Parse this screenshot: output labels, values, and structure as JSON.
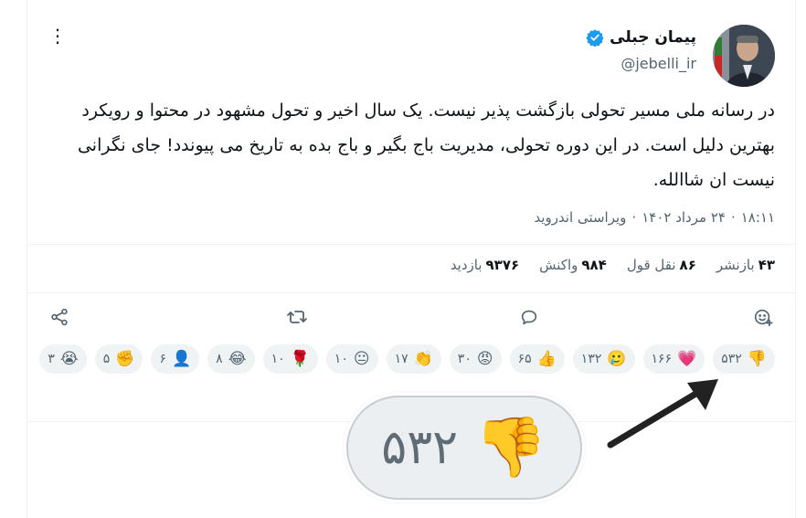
{
  "author": {
    "name": "پیمان جبلی",
    "handle": "@jebelli_ir",
    "verified_icon": "verified-badge-icon",
    "verified_color": "#1d9bf0"
  },
  "tweet": {
    "text": "در رسانه ملی مسیر تحولی بازگشت پذیر نیست. یک سال اخیر و تحول مشهود در محتوا و رویکرد بهترین دلیل است. در این دوره تحولی، مدیریت باج بگیر و باج بده به تاریخ می پیوندد! جای نگرانی نیست ان شاالله.",
    "time": "۱۸:۱۱",
    "date": "۲۴ مرداد ۱۴۰۲",
    "client": "ویراستی اندروید",
    "sep": "·"
  },
  "stats": [
    {
      "value": "۴۳",
      "label": "بازنشر"
    },
    {
      "value": "۸۶",
      "label": "نقل قول"
    },
    {
      "value": "۹۸۴",
      "label": "واکنش"
    },
    {
      "value": "۹۳۷۶",
      "label": "بازدید"
    }
  ],
  "actions": {
    "react": "add-reaction-icon",
    "reply": "reply-icon",
    "retweet": "retweet-icon",
    "share": "share-icon"
  },
  "reactions": [
    {
      "emoji": "👎",
      "count": "۵۳۲",
      "icon": "thumbs-down-icon"
    },
    {
      "emoji": "💗",
      "count": "۱۶۶",
      "icon": "heart-icon"
    },
    {
      "emoji": "🥲",
      "count": "۱۳۲",
      "icon": "smiling-tear-icon"
    },
    {
      "emoji": "👍",
      "count": "۶۵",
      "icon": "thumbs-up-icon"
    },
    {
      "emoji": "😡",
      "count": "۳۰",
      "icon": "angry-face-icon"
    },
    {
      "emoji": "👏",
      "count": "۱۷",
      "icon": "clapping-icon"
    },
    {
      "emoji": "😐",
      "count": "۱۰",
      "icon": "neutral-face-icon"
    },
    {
      "emoji": "🌹",
      "count": "۱۰",
      "icon": "rose-icon"
    },
    {
      "emoji": "😂",
      "count": "۸",
      "icon": "laughing-face-icon"
    },
    {
      "emoji": "👤",
      "count": "۶",
      "icon": "person-icon"
    },
    {
      "emoji": "✊",
      "count": "۵",
      "icon": "raised-fist-icon"
    },
    {
      "emoji": "😭",
      "count": "۳",
      "icon": "crying-face-icon"
    }
  ],
  "zoom": {
    "emoji": "👎",
    "count": "۵۳۲"
  }
}
